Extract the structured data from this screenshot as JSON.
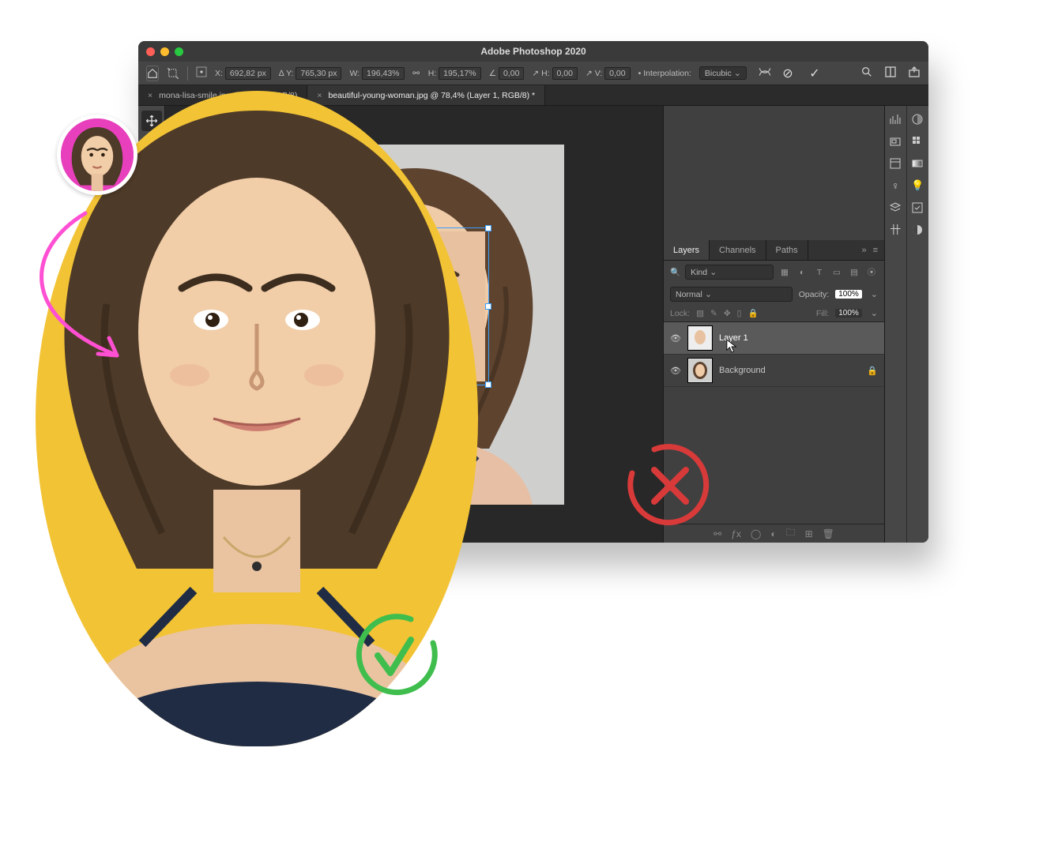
{
  "window": {
    "title": "Adobe Photoshop 2020"
  },
  "options": {
    "x_label": "X:",
    "x": "692,82 px",
    "y_label": "Y:",
    "y": "765,30 px",
    "w_label": "W:",
    "w": "196,43%",
    "h_label": "H:",
    "h": "195,17%",
    "angle_label": "∠",
    "angle": "0,00",
    "skewh_label": "H:",
    "skewh": "0,00",
    "skewv_label": "V:",
    "skewv": "0,00",
    "interp_label": "Interpolation:",
    "interp_value": "Bicubic"
  },
  "tabs": [
    {
      "label": "mona-lisa-smile.jpg @ 248% (RGB/8)",
      "active": false
    },
    {
      "label": "beautiful-young-woman.jpg @ 78,4% (Layer 1, RGB/8) *",
      "active": true
    }
  ],
  "panel_tabs": {
    "layers": "Layers",
    "channels": "Channels",
    "paths": "Paths"
  },
  "layers": {
    "kind_placeholder": "Kind",
    "blend_mode": "Normal",
    "opacity_label": "Opacity:",
    "opacity": "100%",
    "lock_label": "Lock:",
    "fill_label": "Fill:",
    "fill": "100%",
    "list": [
      {
        "name": "Layer 1",
        "locked": false,
        "selected": true
      },
      {
        "name": "Background",
        "locked": true,
        "selected": false
      }
    ]
  },
  "colors": {
    "yellow": "#f2c335",
    "pink": "#e83fbc",
    "green": "#3fbe4e",
    "red": "#d83a3a",
    "arrow": "#ff4fd2"
  }
}
